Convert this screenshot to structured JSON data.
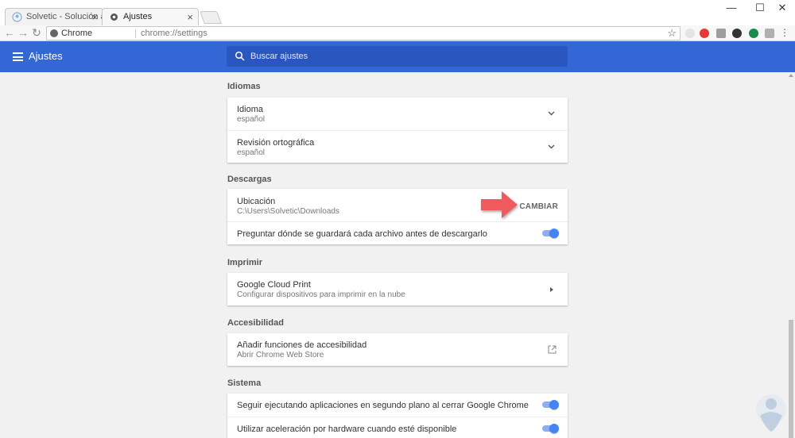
{
  "browser": {
    "tabs": [
      {
        "title": "Solvetic - Solución a los p",
        "close": "×"
      },
      {
        "title": "Ajustes",
        "close": "×"
      }
    ],
    "window_controls": {
      "minimize": "—",
      "maximize": "☐",
      "close": "✕"
    },
    "omnibox": {
      "site": "Chrome",
      "url": "chrome://settings"
    }
  },
  "header": {
    "title": "Ajustes",
    "search_placeholder": "Buscar ajustes"
  },
  "sections": {
    "idiomas": {
      "title": "Idiomas",
      "rows": [
        {
          "label": "Idioma",
          "value": "español"
        },
        {
          "label": "Revisión ortográfica",
          "value": "español"
        }
      ]
    },
    "descargas": {
      "title": "Descargas",
      "location_label": "Ubicación",
      "location_value": "C:\\Users\\Solvetic\\Downloads",
      "change_button": "CAMBIAR",
      "ask_label": "Preguntar dónde se guardará cada archivo antes de descargarlo",
      "ask_enabled": true
    },
    "imprimir": {
      "title": "Imprimir",
      "label": "Google Cloud Print",
      "value": "Configurar dispositivos para imprimir en la nube"
    },
    "accesibilidad": {
      "title": "Accesibilidad",
      "label": "Añadir funciones de accesibilidad",
      "value": "Abrir Chrome Web Store"
    },
    "sistema": {
      "title": "Sistema",
      "rows": [
        {
          "label": "Seguir ejecutando aplicaciones en segundo plano al cerrar Google Chrome",
          "enabled": true
        },
        {
          "label": "Utilizar aceleración por hardware cuando esté disponible",
          "enabled": true
        }
      ]
    }
  },
  "colors": {
    "appbar": "#3367d6",
    "toggle_on": "#4285f4",
    "annotation_arrow": "#f05a5f"
  }
}
